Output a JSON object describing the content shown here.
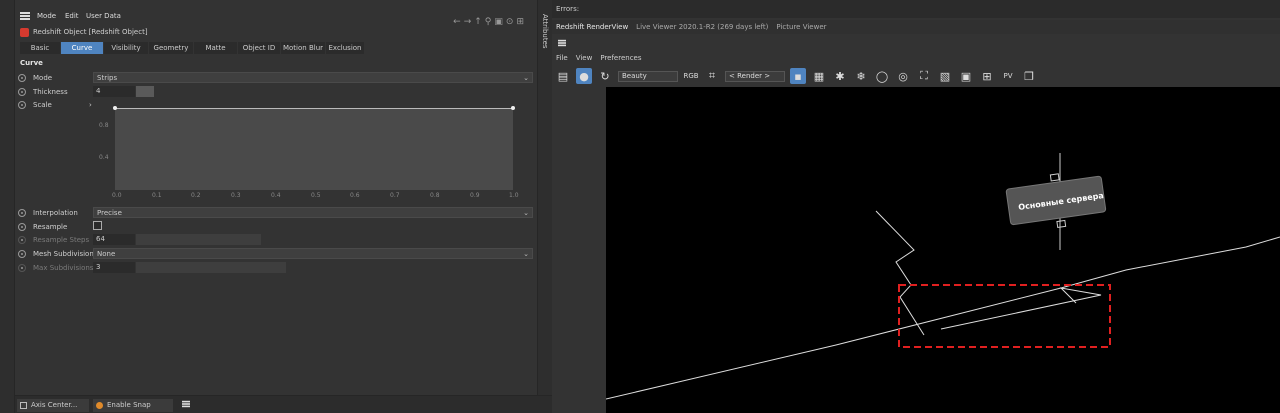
{
  "app": {
    "menu": [
      "Mode",
      "Edit",
      "User Data"
    ],
    "object_title": "Redshift Object [Redshift Object]"
  },
  "tabs": [
    {
      "label": "Basic",
      "active": false
    },
    {
      "label": "Curve",
      "active": true
    },
    {
      "label": "Visibility",
      "active": false
    },
    {
      "label": "Geometry",
      "active": false
    },
    {
      "label": "Matte",
      "active": false
    },
    {
      "label": "Object ID",
      "active": false
    },
    {
      "label": "Motion Blur",
      "active": false
    },
    {
      "label": "Exclusion",
      "active": false
    }
  ],
  "curve": {
    "heading": "Curve",
    "mode_label": "Mode",
    "mode_value": "Strips",
    "thickness_label": "Thickness",
    "thickness_value": "4",
    "scale_label": "Scale",
    "graph_y": [
      "0.8",
      "0.4"
    ],
    "graph_x": [
      "0.0",
      "0.1",
      "0.2",
      "0.3",
      "0.4",
      "0.5",
      "0.6",
      "0.7",
      "0.8",
      "0.9",
      "1.0"
    ],
    "interpolation_label": "Interpolation",
    "interpolation_value": "Precise",
    "resample_label": "Resample",
    "resample_checked": false,
    "resample_steps_label": "Resample Steps",
    "resample_steps_value": "64",
    "mesh_subdiv_label": "Mesh Subdivision",
    "mesh_subdiv_value": "None",
    "max_subdiv_label": "Max Subdivisions",
    "max_subdiv_value": "3"
  },
  "side_tab": "Attributes",
  "bottom": {
    "axis_center": "Axis Center...",
    "enable_snap": "Enable Snap"
  },
  "renderview": {
    "errors_label": "Errors:",
    "tabs": [
      "Redshift RenderView",
      "Live Viewer 2020.1-R2 (269 days left)",
      "Picture Viewer"
    ],
    "menu": [
      "File",
      "View",
      "Preferences"
    ],
    "aov_value": "Beauty",
    "camera_value": "< Render >",
    "sign_text": "Основные сервера"
  },
  "colors": {
    "accent": "#4f84c0",
    "highlight_box": "#e02020"
  }
}
